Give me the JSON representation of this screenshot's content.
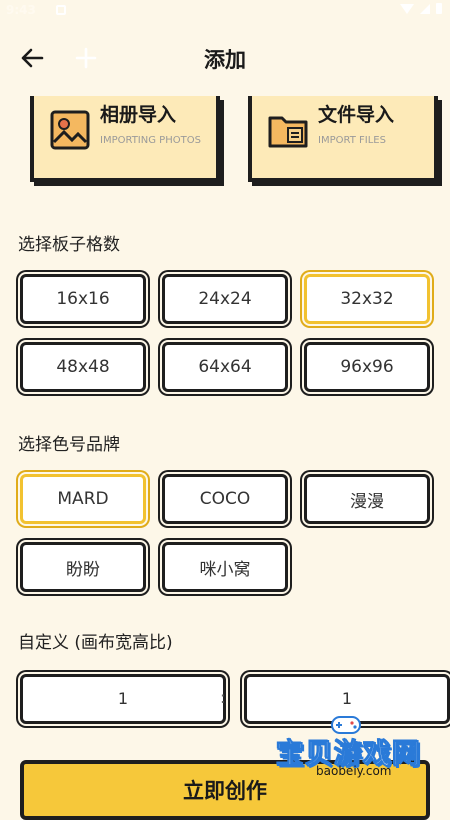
{
  "status_bar": {
    "time": "9:43"
  },
  "header": {
    "title": "添加"
  },
  "import": [
    {
      "title": "相册导入",
      "subtitle": "IMPORTING PHOTOS"
    },
    {
      "title": "文件导入",
      "subtitle": "IMPORT FILES"
    }
  ],
  "grid_section": {
    "label": "选择板子格数",
    "options": [
      "16x16",
      "24x24",
      "32x32",
      "48x48",
      "64x64",
      "96x96"
    ],
    "selected": "32x32"
  },
  "brand_section": {
    "label": "选择色号品牌",
    "options": [
      "MARD",
      "COCO",
      "漫漫",
      "盼盼",
      "咪小窝"
    ],
    "selected": "MARD"
  },
  "custom_section": {
    "label": "自定义 (画布宽高比)",
    "width_value": "1",
    "separator": ":",
    "height_value": "1"
  },
  "create_button": {
    "label": "立即创作"
  },
  "watermark": {
    "text": "宝贝游戏网",
    "url": "baobeiy.com"
  },
  "colors": {
    "accent": "#f6c83a",
    "card_bg": "#fdeab8",
    "page_bg": "#fdf7e8",
    "border": "#1e1e1e"
  }
}
